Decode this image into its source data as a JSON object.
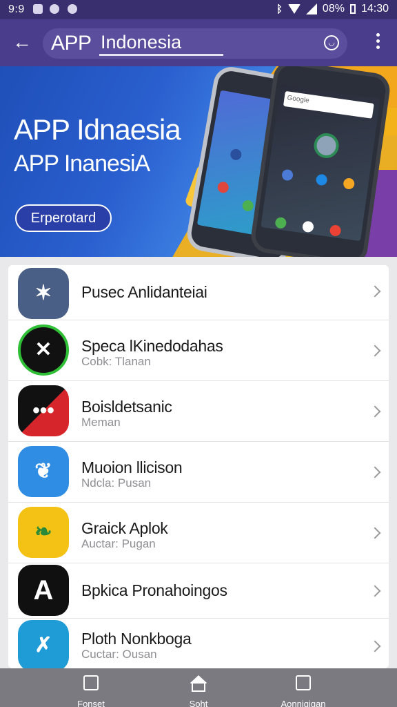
{
  "status_bar": {
    "time": "9:9",
    "battery": "08%",
    "clock": "14:30"
  },
  "toolbar": {
    "title": "APP",
    "search_value": "Indonesia",
    "search_placeholder": "App"
  },
  "banner": {
    "headline": "APP Idnaesia",
    "subheadline": "APP InanesiA",
    "button_label": "Erperotard",
    "phone_search": "Google"
  },
  "apps": [
    {
      "name": "Pusec Anlidanteiai",
      "subtitle": "",
      "icon": "compass-icon",
      "color": "#4a5f86"
    },
    {
      "name": "Speca lKinedodahas",
      "subtitle": "Cobk: Tlanan",
      "icon": "x-logo-icon",
      "color": "#111111"
    },
    {
      "name": "Boisldetsanic",
      "subtitle": "Meman",
      "icon": "red-face-icon",
      "color": "#d7262b"
    },
    {
      "name": "Muoion llicison",
      "subtitle": "Ndcla: Pusan",
      "icon": "blue-leaf-icon",
      "color": "#2f8de4"
    },
    {
      "name": "Graick Aplok",
      "subtitle": "Auctar: Pugan",
      "icon": "yellow-leaf-icon",
      "color": "#f3c214"
    },
    {
      "name": "Bpkica Pronahoingos",
      "subtitle": "",
      "icon": "a-logo-icon",
      "color": "#101010"
    },
    {
      "name": "Ploth Nonkboga",
      "subtitle": "Cuctar: Ousan",
      "icon": "cyan-arrow-icon",
      "color": "#1f9bd6"
    }
  ],
  "bottom_nav": [
    {
      "label": "Fonset",
      "icon": "square-icon"
    },
    {
      "label": "Soht",
      "icon": "home-icon"
    },
    {
      "label": "Aonnigigan",
      "icon": "gallery-icon"
    }
  ]
}
